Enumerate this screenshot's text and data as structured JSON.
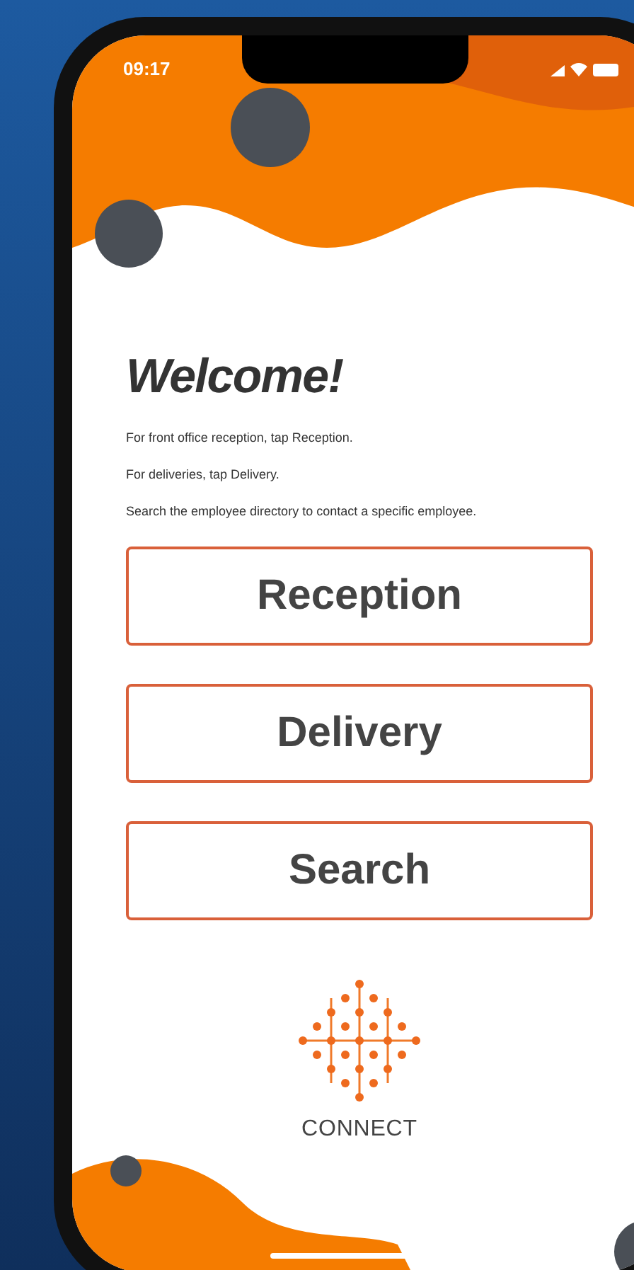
{
  "status_bar": {
    "time": "09:17"
  },
  "welcome": {
    "title": "Welcome!",
    "lines": [
      "For front office reception, tap Reception.",
      "For deliveries, tap Delivery.",
      "Search the employee directory to contact a specific employee."
    ]
  },
  "buttons": [
    {
      "label": "Reception"
    },
    {
      "label": "Delivery"
    },
    {
      "label": "Search"
    }
  ],
  "logo": {
    "name": "CONNECT"
  }
}
